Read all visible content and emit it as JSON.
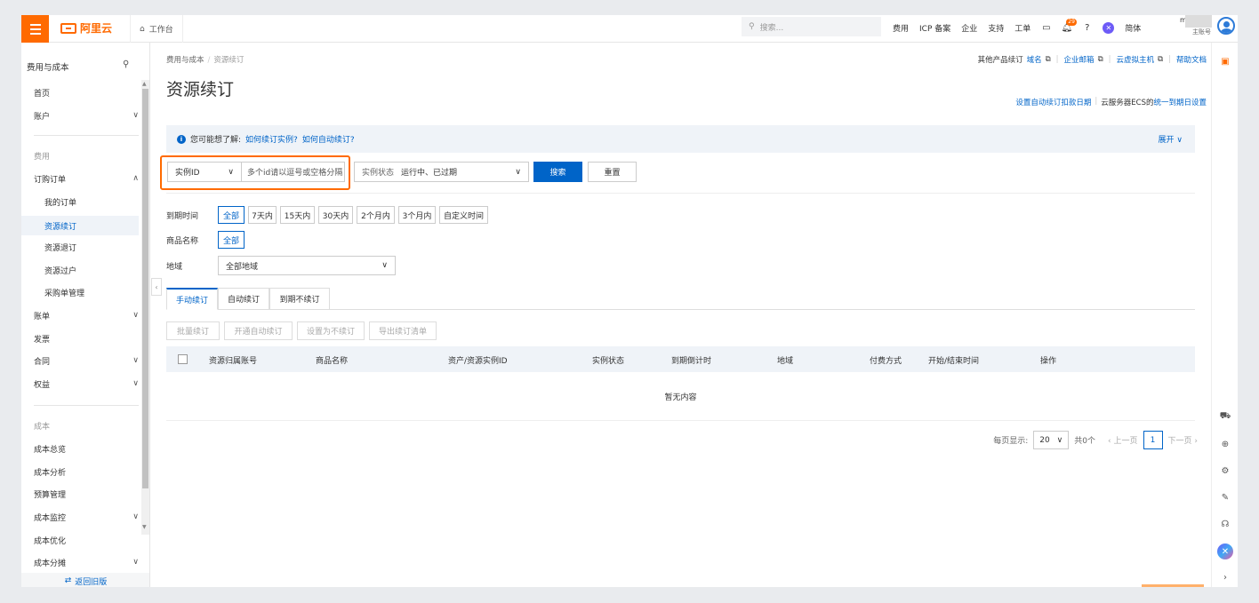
{
  "topbar": {
    "logo_text": "阿里云",
    "workbench": "工作台",
    "search_placeholder": "搜索...",
    "nav": [
      "费用",
      "ICP 备案",
      "企业",
      "支持",
      "工单"
    ],
    "badge_count": "29",
    "lang": "简体",
    "user_initial": "m",
    "user_role": "主账号"
  },
  "sidebar": {
    "title": "费用与成本",
    "items": [
      {
        "label": "首页"
      },
      {
        "label": "账户"
      },
      {
        "label": "费用"
      },
      {
        "label": "订购订单"
      },
      {
        "label": "我的订单"
      },
      {
        "label": "资源续订"
      },
      {
        "label": "资源退订"
      },
      {
        "label": "资源过户"
      },
      {
        "label": "采购单管理"
      },
      {
        "label": "账单"
      },
      {
        "label": "发票"
      },
      {
        "label": "合同"
      },
      {
        "label": "权益"
      },
      {
        "label": "成本"
      },
      {
        "label": "成本总览"
      },
      {
        "label": "成本分析"
      },
      {
        "label": "预算管理"
      },
      {
        "label": "成本监控"
      },
      {
        "label": "成本优化"
      },
      {
        "label": "成本分摊"
      }
    ],
    "back_old": "返回旧版"
  },
  "main": {
    "breadcrumb": [
      "费用与成本",
      "资源续订"
    ],
    "ext": {
      "prefix": "其他产品续订",
      "links": [
        "域名",
        "企业邮箱",
        "云虚拟主机"
      ],
      "help": "帮助文档"
    },
    "title": "资源续订",
    "auto_links": {
      "left": "设置自动续订扣款日期",
      "mid": "云服务器ECS的",
      "right": "统一到期日设置"
    },
    "tip": {
      "text": "您可能想了解:",
      "q1": "如何续订实例?",
      "q2": "如何自动续订?",
      "expand": "展开"
    },
    "filter": {
      "id_select": "实例ID",
      "id_placeholder": "多个id请以逗号或空格分隔",
      "status_label": "实例状态",
      "status_value": "运行中、已过期",
      "search_btn": "搜索",
      "reset_btn": "重置"
    },
    "expire": {
      "label": "到期时间",
      "options": [
        "全部",
        "7天内",
        "15天内",
        "30天内",
        "2个月内",
        "3个月内",
        "自定义时间"
      ]
    },
    "product": {
      "label": "商品名称",
      "value": "全部"
    },
    "region": {
      "label": "地域",
      "value": "全部地域"
    },
    "tabs": [
      "手动续订",
      "自动续订",
      "到期不续订"
    ],
    "actions": [
      "批量续订",
      "开通自动续订",
      "设置为不续订",
      "导出续订清单"
    ],
    "columns": [
      "资源归属账号",
      "商品名称",
      "资产/资源实例ID",
      "实例状态",
      "到期倒计时",
      "地域",
      "付费方式",
      "开始/结束时间",
      "操作"
    ],
    "empty": "暂无内容",
    "pager": {
      "per_page_label": "每页显示:",
      "per_page": "20",
      "total": "共0个",
      "prev": "上一页",
      "page": "1",
      "next": "下一页"
    }
  },
  "colors": {
    "accent": "#ff6a00",
    "link": "#0064c8",
    "tip_bg": "#eff3f8"
  }
}
